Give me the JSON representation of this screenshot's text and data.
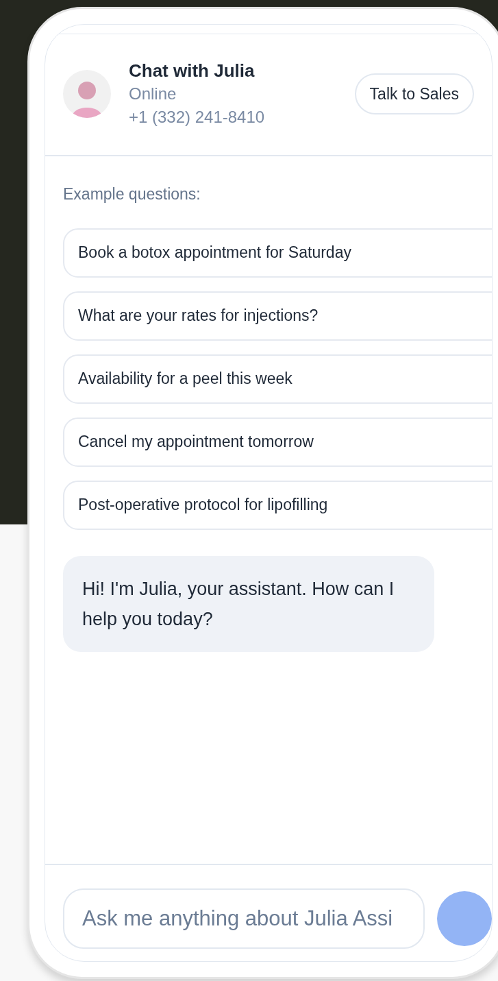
{
  "header": {
    "title": "Chat with Julia",
    "status": "Online",
    "phone": "+1 (332) 241-8410",
    "action_button": "Talk to Sales"
  },
  "examples": {
    "heading": "Example questions:",
    "questions": [
      "Book a botox appointment for Saturday",
      "What are your rates for injections?",
      "Availability for a peel this week",
      "Cancel my appointment tomorrow",
      "Post-operative protocol for lipofilling"
    ]
  },
  "messages": [
    {
      "kind": "incoming",
      "text": "Hi! I'm Julia, your assistant. How can I help you today?"
    }
  ],
  "composer": {
    "placeholder": "Ask me anything about Julia Assi"
  }
}
